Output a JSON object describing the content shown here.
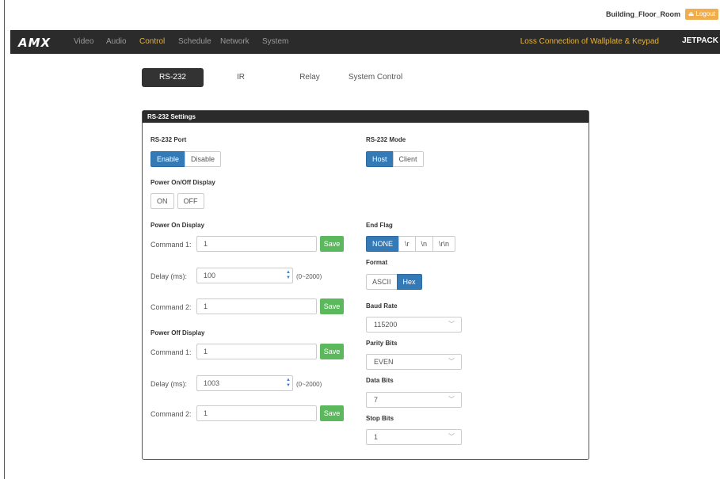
{
  "header": {
    "room": "Building_Floor_Room",
    "logout": "Logout"
  },
  "navbar": {
    "logo": "AMX",
    "items": [
      "Video",
      "Audio",
      "Control",
      "Schedule",
      "Network",
      "System"
    ],
    "active": "Control",
    "warning": "Loss Connection of Wallplate & Keypad",
    "brand": "JETPACK"
  },
  "tabs": [
    "RS-232",
    "IR",
    "Relay",
    "System Control"
  ],
  "panel": {
    "title": "RS-232 Settings",
    "port": {
      "label": "RS-232 Port",
      "options": [
        "Enable",
        "Disable"
      ],
      "selected": "Enable"
    },
    "mode": {
      "label": "RS-232 Mode",
      "options": [
        "Host",
        "Client"
      ],
      "selected": "Host"
    },
    "power_display": {
      "label": "Power On/Off Display",
      "options": [
        "ON",
        "OFF"
      ]
    },
    "power_on": {
      "label": "Power On Display",
      "command1_label": "Command 1:",
      "command1_value": "1",
      "delay_label": "Delay (ms):",
      "delay_value": "100",
      "delay_range": "(0~2000)",
      "command2_label": "Command 2:",
      "command2_value": "1"
    },
    "power_off": {
      "label": "Power Off Display",
      "command1_label": "Command 1:",
      "command1_value": "1",
      "delay_label": "Delay (ms):",
      "delay_value": "1003",
      "delay_range": "(0~2000)",
      "command2_label": "Command 2:",
      "command2_value": "1"
    },
    "save_label": "Save",
    "end_flag": {
      "label": "End Flag",
      "options": [
        "NONE",
        "\\r",
        "\\n",
        "\\r\\n"
      ],
      "selected": "NONE"
    },
    "format": {
      "label": "Format",
      "options": [
        "ASCII",
        "Hex"
      ],
      "selected": "Hex"
    },
    "baud_rate": {
      "label": "Baud Rate",
      "value": "115200"
    },
    "parity_bits": {
      "label": "Parity Bits",
      "value": "EVEN"
    },
    "data_bits": {
      "label": "Data Bits",
      "value": "7"
    },
    "stop_bits": {
      "label": "Stop Bits",
      "value": "1"
    }
  },
  "colors": {
    "primary": "#337ab7",
    "success": "#5cb85c",
    "warning": "#f0ad4e",
    "nav_active": "#e5b23b",
    "dark": "#2b2b2b"
  }
}
